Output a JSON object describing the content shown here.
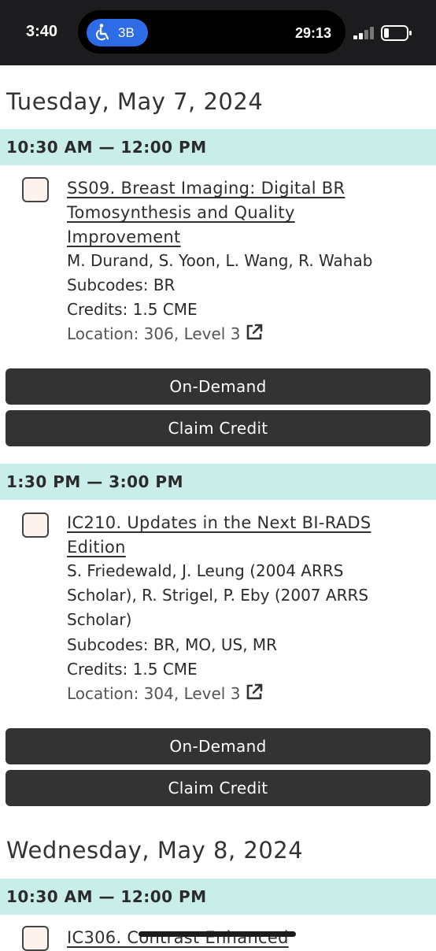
{
  "status_bar": {
    "time": "3:40",
    "pill_label": "3B",
    "pill_icon": "accessibility-icon",
    "timer": "29:13",
    "signal_icon": "cellular-signal-icon",
    "battery_icon": "battery-icon"
  },
  "days": [
    {
      "heading": "Tuesday, May 7, 2024",
      "slots": [
        {
          "time": "10:30 AM — 12:00 PM",
          "title_lines": [
            "SS09. Breast Imaging: Digital BR",
            "Tomosynthesis and Quality",
            "Improvement"
          ],
          "speakers_lines": [
            "M. Durand, S. Yoon, L. Wang, R. Wahab"
          ],
          "subcodes": "Subcodes: BR",
          "credits": "Credits: 1.5 CME",
          "location": "Location: 306, Level 3",
          "buttons": [
            "On-Demand",
            "Claim Credit"
          ]
        },
        {
          "time": "1:30 PM — 3:00 PM",
          "title_lines": [
            "IC210. Updates in the Next BI-RADS",
            "Edition"
          ],
          "speakers_lines": [
            "S. Friedewald, J. Leung (2004 ARRS",
            "Scholar), R. Strigel, P. Eby (2007 ARRS",
            "Scholar)"
          ],
          "subcodes": "Subcodes: BR, MO, US, MR",
          "credits": "Credits: 1.5 CME",
          "location": "Location: 304, Level 3",
          "buttons": [
            "On-Demand",
            "Claim Credit"
          ]
        }
      ]
    },
    {
      "heading": "Wednesday, May 8, 2024",
      "slots": [
        {
          "time": "10:30 AM — 12:00 PM",
          "title_lines": [
            "IC306. Contrast Enhanced"
          ]
        }
      ]
    }
  ]
}
